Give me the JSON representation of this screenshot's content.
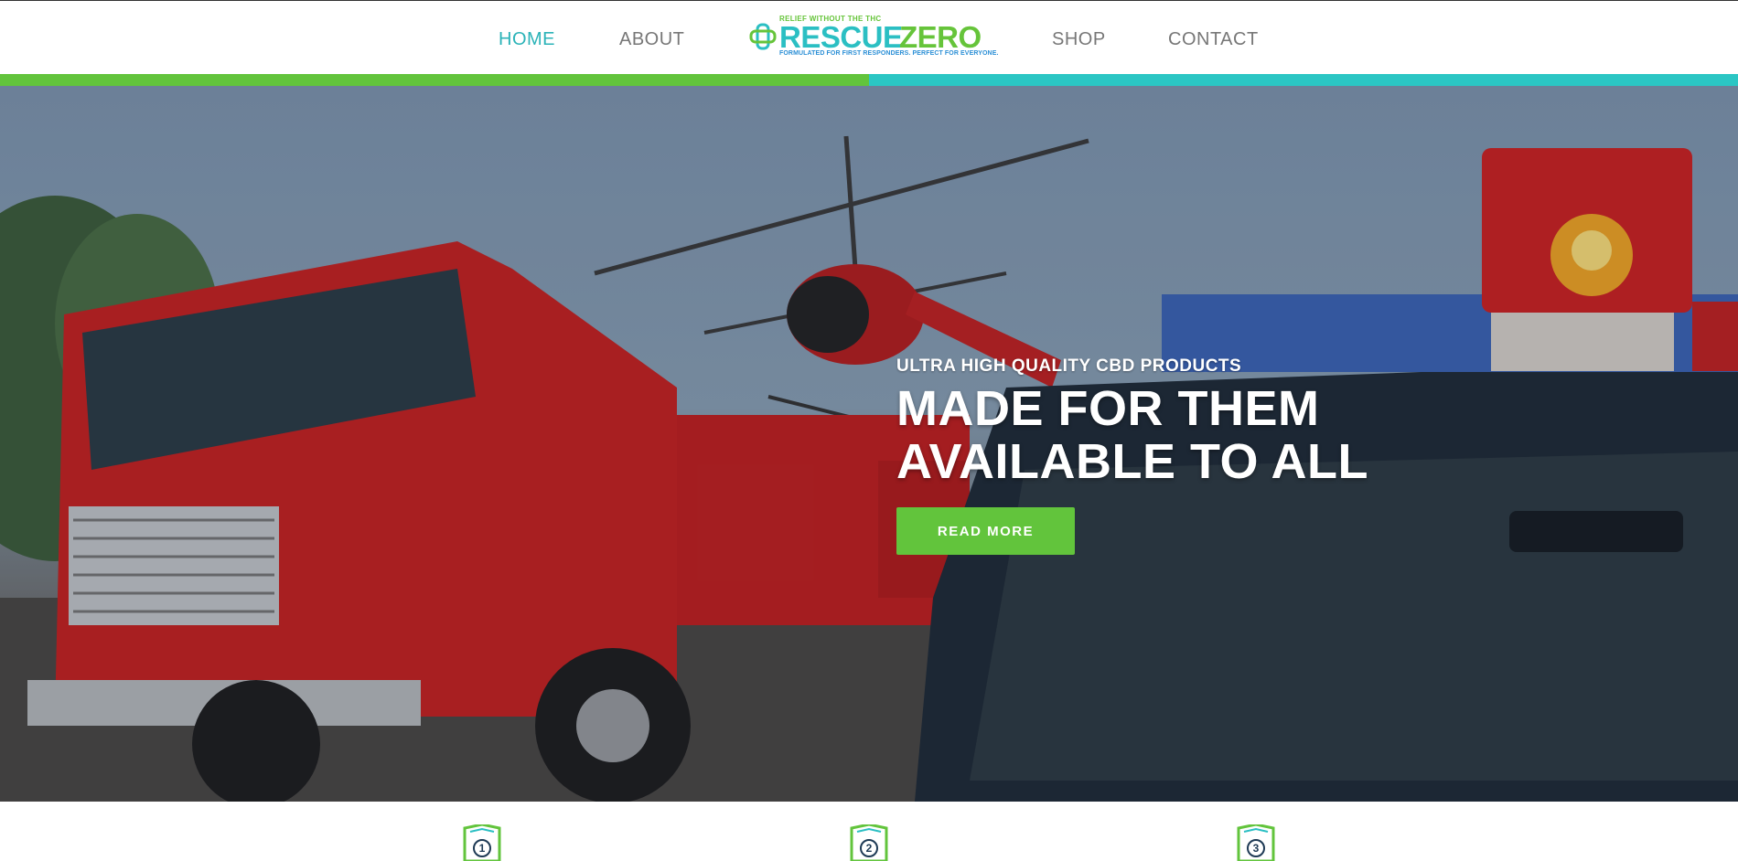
{
  "nav": {
    "home": "HOME",
    "about": "ABOUT",
    "shop": "SHOP",
    "contact": "CONTACT"
  },
  "logo": {
    "tagline": "RELIEF WITHOUT THE THC",
    "word_1": "RESCUE",
    "word_2": "ZERO",
    "subline": "FORMULATED FOR FIRST RESPONDERS. PERFECT FOR EVERYONE."
  },
  "hero": {
    "eyebrow": "ULTRA HIGH QUALITY CBD PRODUCTS",
    "headline_line_1": "MADE FOR THEM",
    "headline_line_2": "AVAILABLE TO ALL",
    "button_label": "READ MORE"
  },
  "features": [
    {
      "number": "1"
    },
    {
      "number": "2"
    },
    {
      "number": "3"
    }
  ],
  "colors": {
    "teal": "#2bbfc3",
    "green": "#62c43c",
    "nav_active": "#2bb3b8",
    "nav_default": "#777777"
  }
}
